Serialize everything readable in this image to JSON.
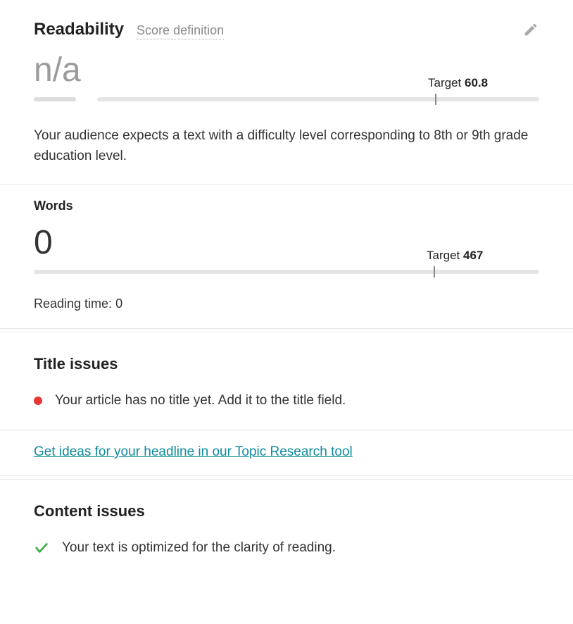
{
  "readability": {
    "title": "Readability",
    "score_def_label": "Score definition",
    "value": "n/a",
    "target_label": "Target",
    "target_value": "60.8",
    "description": "Your audience expects a text with a difficulty level corresponding to 8th or 9th grade education level."
  },
  "words": {
    "title": "Words",
    "value": "0",
    "target_label": "Target",
    "target_value": "467",
    "reading_time_label": "Reading time:",
    "reading_time_value": "0"
  },
  "title_issues": {
    "title": "Title issues",
    "items": [
      {
        "status": "error",
        "text": "Your article has no title yet. Add it to the title field."
      }
    ],
    "link_text": "Get ideas for your headline in our Topic Research tool"
  },
  "content_issues": {
    "title": "Content issues",
    "items": [
      {
        "status": "ok",
        "text": "Your text is optimized for the clarity of reading."
      }
    ]
  }
}
